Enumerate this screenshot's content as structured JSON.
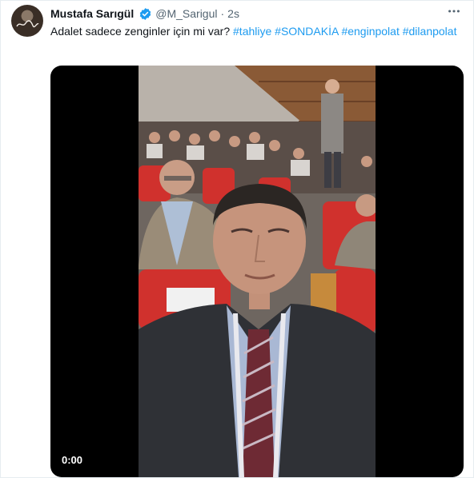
{
  "tweet": {
    "author_name": "Mustafa Sarıgül",
    "handle": "@M_Sarigul",
    "separator": "·",
    "time": "2s",
    "text_plain": "Adalet sadece zenginler için mi var?",
    "hashtags": [
      "#tahliye",
      "#SONDAKİA",
      "#enginpolat",
      "#dilanpolat"
    ]
  },
  "video": {
    "timecode": "0:00"
  },
  "icons": {
    "avatar": "avatar",
    "verified": "verified-badge-icon",
    "more": "more-options-icon"
  },
  "colors": {
    "link": "#1d9bf0",
    "verified": "#1d9bf0",
    "muted": "#536471",
    "seat_red": "#d0312d",
    "video_bg": "#000000"
  }
}
